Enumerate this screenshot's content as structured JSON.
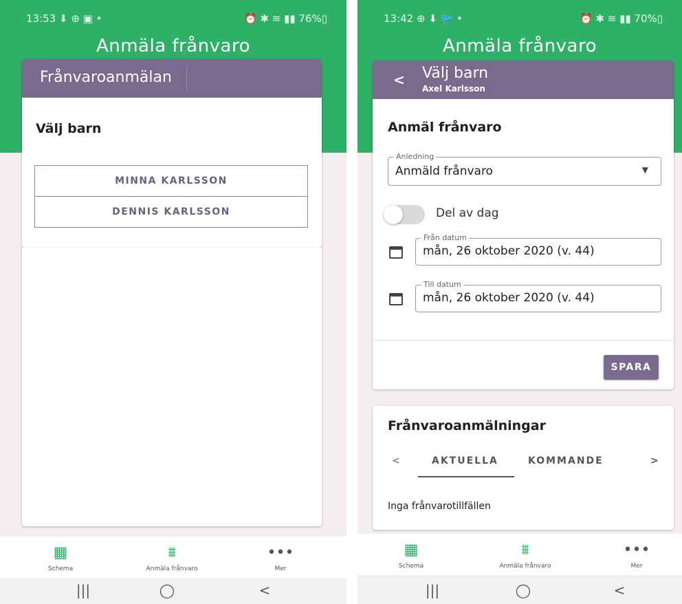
{
  "left": {
    "status": {
      "time": "13:53 ⬇ ⊕ ▣ •",
      "right": "⏰ ✱ ≋ ▮▮ 76%▯"
    },
    "app_title": "Anmäla frånvaro",
    "card_header": "Frånvaroanmälan",
    "section_title": "Välj barn",
    "children": [
      "MINNA KARLSSON",
      "DENNIS KARLSSON"
    ],
    "bottom_nav": [
      {
        "label": "Schema",
        "icon": "calendar-grid-icon"
      },
      {
        "label": "Anmäla frånvaro",
        "icon": "desk-icon"
      },
      {
        "label": "Mer",
        "icon": "more-dots-icon"
      }
    ],
    "sys_nav": {
      "recents": "|||",
      "home": "◯",
      "back": "<"
    }
  },
  "right": {
    "status": {
      "time": "13:42 ⊕ ⬇ 🐦 •",
      "right": "⏰ ✱ ≋ ▮▮ 70%▯"
    },
    "app_title": "Anmäla frånvaro",
    "header": {
      "back": "<",
      "title": "Välj barn",
      "subtitle": "Axel Karlsson"
    },
    "form_title": "Anmäl frånvaro",
    "reason": {
      "label": "Anledning",
      "value": "Anmäld frånvaro"
    },
    "part_of_day": {
      "label": "Del av dag",
      "checked": false
    },
    "from_date": {
      "label": "Från datum",
      "value": "mån, 26 oktober 2020 (v. 44)"
    },
    "to_date": {
      "label": "Till datum",
      "value": "mån, 26 oktober 2020 (v. 44)"
    },
    "save_label": "SPARA",
    "list_title": "Frånvaroanmälningar",
    "tabs": [
      "AKTUELLA",
      "KOMMANDE"
    ],
    "tab_prev": "<",
    "tab_next": ">",
    "empty_text": "Inga frånvarotillfällen",
    "bottom_nav": [
      {
        "label": "Schema",
        "icon": "calendar-grid-icon"
      },
      {
        "label": "Anmäla frånvaro",
        "icon": "desk-icon"
      },
      {
        "label": "Mer",
        "icon": "more-dots-icon"
      }
    ],
    "sys_nav": {
      "recents": "|||",
      "home": "◯",
      "back": "<"
    }
  },
  "colors": {
    "brand_green": "#2eb066",
    "header_purple": "#7a6a8e",
    "background": "#f4efee"
  }
}
